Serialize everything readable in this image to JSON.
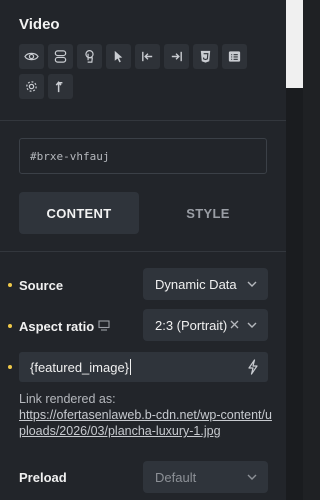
{
  "panel": {
    "title": "Video",
    "toolbar_row1": [
      "eye-icon",
      "toggle-icon",
      "hand-icon",
      "pointer-icon",
      "align-left-icon",
      "align-right-icon",
      "css-icon",
      "list-icon"
    ],
    "toolbar_row2": [
      "gear-icon",
      "arrow-up-icon"
    ]
  },
  "element_id": {
    "value": "#brxe-vhfauj"
  },
  "tabs": [
    {
      "label": "CONTENT",
      "active": true
    },
    {
      "label": "STYLE",
      "active": false
    }
  ],
  "controls": {
    "source": {
      "label": "Source",
      "value": "Dynamic Data"
    },
    "aspect_ratio": {
      "label": "Aspect ratio",
      "value": "2:3 (Portrait)"
    },
    "dynamic_field": {
      "value": "{featured_image}"
    },
    "link_rendered": {
      "label": "Link rendered as:",
      "url": "https://ofertasenlaweb.b-cdn.net/wp-content/uploads/2026/03/plancha-luxury-1.jpg"
    },
    "preload": {
      "label": "Preload",
      "placeholder": "Default"
    }
  },
  "colors": {
    "accent_dot": "#f0c94a",
    "panel_bg": "#22252a",
    "control_bg": "#2f343b"
  }
}
